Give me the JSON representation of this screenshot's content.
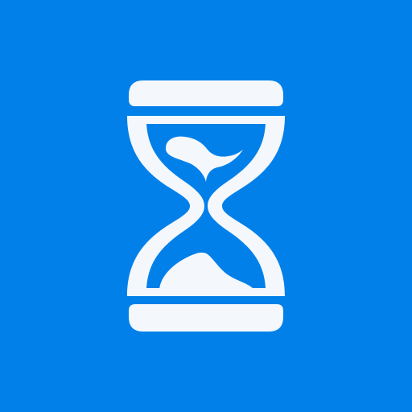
{
  "icon": {
    "name": "hourglass-icon",
    "background_color": "#0280EA",
    "glyph_color": "#F4F8FC"
  }
}
